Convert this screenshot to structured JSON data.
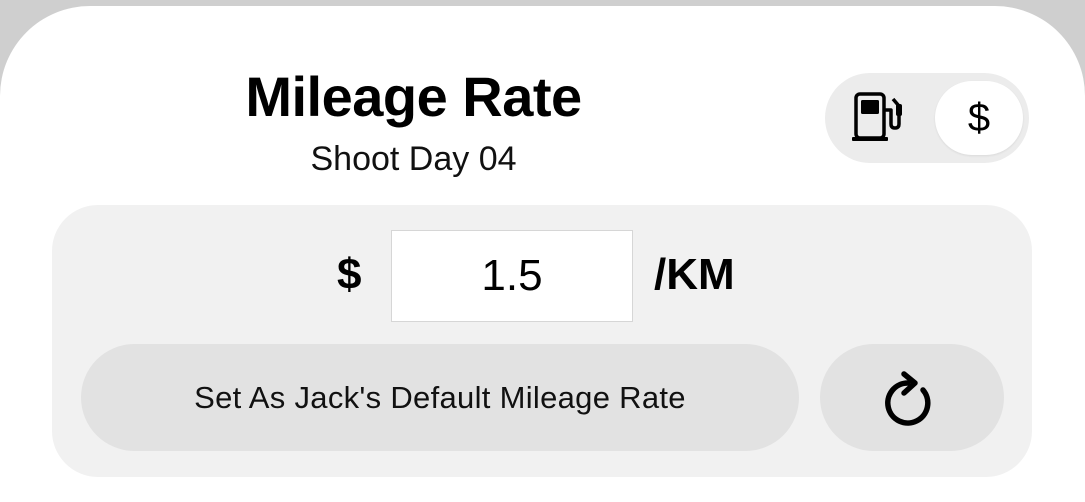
{
  "header": {
    "title": "Mileage Rate",
    "subtitle": "Shoot Day 04"
  },
  "mode_toggle": {
    "options": [
      {
        "icon": "fuel-pump-icon",
        "selected": false
      },
      {
        "label": "$",
        "icon": "dollar-icon",
        "selected": true
      }
    ]
  },
  "rate": {
    "currency_symbol": "$",
    "value": "1.5",
    "unit": "/KM"
  },
  "actions": {
    "set_default_label": "Set As Jack's Default Mileage Rate",
    "reset_icon": "refresh-icon"
  },
  "colors": {
    "background": "#ffffff",
    "panel": "#f1f1f1",
    "button": "#e2e2e2",
    "toggle_track": "#ececec"
  }
}
